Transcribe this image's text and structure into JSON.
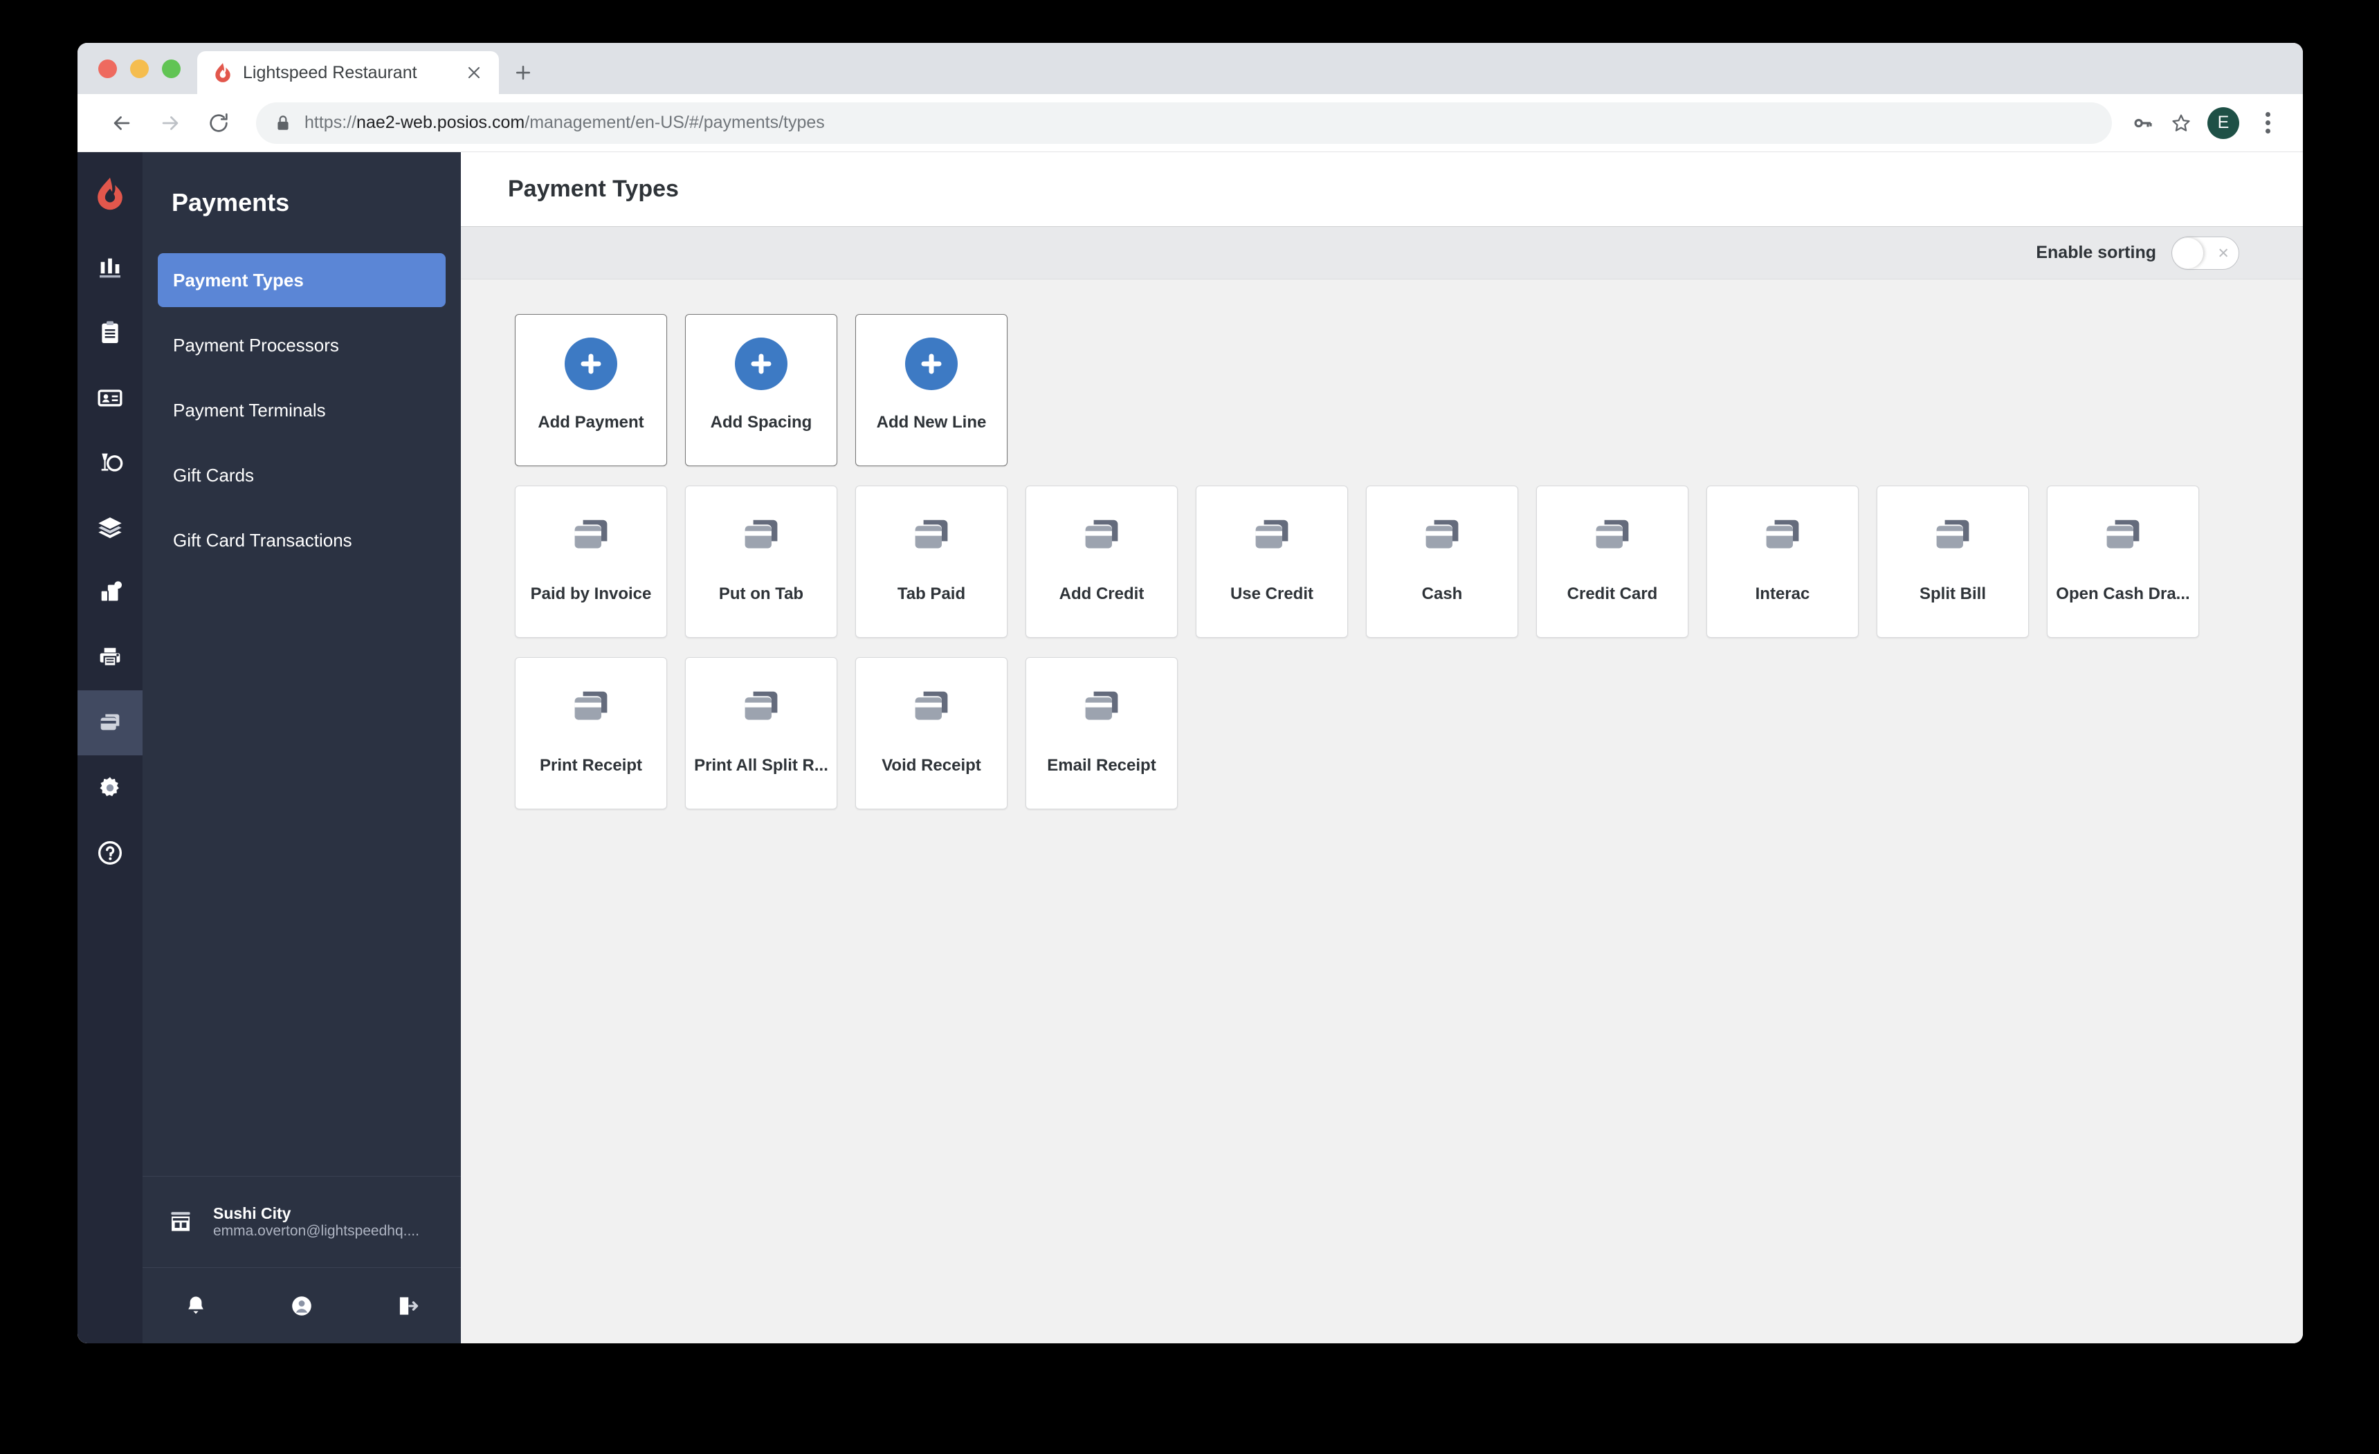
{
  "browser": {
    "tab": {
      "title": "Lightspeed Restaurant",
      "favicon_icon": "lightspeed-flame-icon",
      "close_icon": "close-icon"
    },
    "new_tab_icon": "plus-icon",
    "nav": {
      "back_icon": "arrow-left-icon",
      "forward_icon": "arrow-right-icon",
      "reload_icon": "reload-icon"
    },
    "omnibox": {
      "lock_icon": "lock-icon",
      "url_scheme": "https://",
      "url_host": "nae2-web.posios.com",
      "url_path": "/management/en-US/#/payments/types",
      "url_full": "https://nae2-web.posios.com/management/en-US/#/payments/types"
    },
    "toolbar_icons": [
      {
        "name": "password-key-icon"
      },
      {
        "name": "bookmark-star-icon"
      }
    ],
    "profile": {
      "initial": "E",
      "color": "#1e5046"
    },
    "menu_icon": "kebab-menu-icon"
  },
  "rail": {
    "logo_icon": "lightspeed-logo-icon",
    "items": [
      {
        "icon": "bar-chart-icon",
        "name": "reports",
        "active": false
      },
      {
        "icon": "clipboard-icon",
        "name": "menu-management",
        "active": false
      },
      {
        "icon": "id-card-icon",
        "name": "customers",
        "active": false
      },
      {
        "icon": "glass-plate-icon",
        "name": "table-service",
        "active": false
      },
      {
        "icon": "layers-icon",
        "name": "inventory",
        "active": false
      },
      {
        "icon": "devices-icon",
        "name": "devices",
        "active": false
      },
      {
        "icon": "printer-icon",
        "name": "printers",
        "active": false
      },
      {
        "icon": "payment-cards-icon",
        "name": "payments",
        "active": true
      },
      {
        "icon": "gear-icon",
        "name": "settings",
        "active": false
      },
      {
        "icon": "help-circle-icon",
        "name": "help",
        "active": false
      }
    ]
  },
  "sidebar": {
    "title": "Payments",
    "items": [
      {
        "label": "Payment Types",
        "active": true
      },
      {
        "label": "Payment Processors",
        "active": false
      },
      {
        "label": "Payment Terminals",
        "active": false
      },
      {
        "label": "Gift Cards",
        "active": false
      },
      {
        "label": "Gift Card Transactions",
        "active": false
      }
    ],
    "account": {
      "store_icon": "storefront-icon",
      "name": "Sushi City",
      "email": "emma.overton@lightspeedhq...."
    },
    "actions": [
      {
        "icon": "bell-icon",
        "name": "notifications"
      },
      {
        "icon": "user-circle-icon",
        "name": "profile"
      },
      {
        "icon": "logout-icon",
        "name": "logout"
      }
    ]
  },
  "page": {
    "title": "Payment Types",
    "sorting": {
      "label": "Enable sorting",
      "enabled": false,
      "off_mark": "×"
    }
  },
  "grid": {
    "add_buttons": [
      {
        "label": "Add Payment",
        "icon": "plus-icon"
      },
      {
        "label": "Add Spacing",
        "icon": "plus-icon"
      },
      {
        "label": "Add New Line",
        "icon": "plus-icon"
      }
    ],
    "row2": [
      {
        "label": "Paid by Invoice",
        "icon": "payment-cards-icon"
      },
      {
        "label": "Put on Tab",
        "icon": "payment-cards-icon"
      },
      {
        "label": "Tab Paid",
        "icon": "payment-cards-icon"
      },
      {
        "label": "Add Credit",
        "icon": "payment-cards-icon"
      },
      {
        "label": "Use Credit",
        "icon": "payment-cards-icon"
      },
      {
        "label": "Cash",
        "icon": "payment-cards-icon"
      },
      {
        "label": "Credit Card",
        "icon": "payment-cards-icon"
      },
      {
        "label": "Interac",
        "icon": "payment-cards-icon"
      },
      {
        "label": "Split Bill",
        "icon": "payment-cards-icon"
      },
      {
        "label": "Open Cash Dra...",
        "icon": "payment-cards-icon"
      }
    ],
    "row3": [
      {
        "label": "Print Receipt",
        "icon": "payment-cards-icon"
      },
      {
        "label": "Print All Split R...",
        "icon": "payment-cards-icon"
      },
      {
        "label": "Void Receipt",
        "icon": "payment-cards-icon"
      },
      {
        "label": "Email Receipt",
        "icon": "payment-cards-icon"
      }
    ]
  },
  "colors": {
    "accent_blue": "#3d7ac4",
    "sidebar_active": "#5b86d6",
    "rail_bg": "#232838",
    "nav_bg": "#2b3242",
    "brand_red": "#e2574c"
  }
}
